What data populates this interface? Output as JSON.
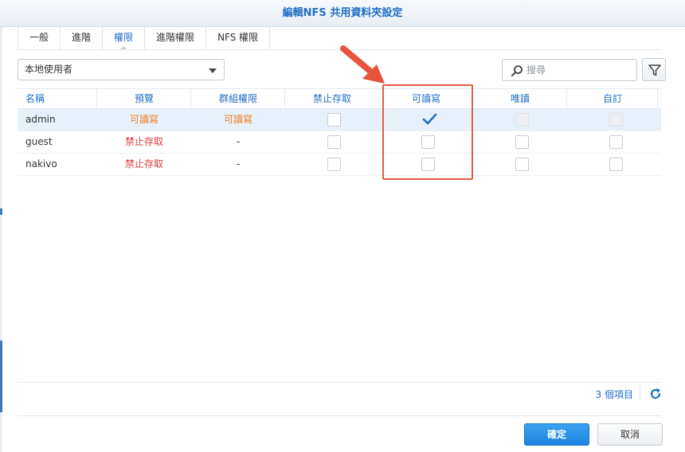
{
  "dialog": {
    "title": "編輯NFS 共用資料夾設定"
  },
  "tabs": [
    {
      "label": "一般"
    },
    {
      "label": "進階"
    },
    {
      "label": "權限"
    },
    {
      "label": "進階權限"
    },
    {
      "label": "NFS 權限"
    }
  ],
  "active_tab": "權限",
  "user_type_select": {
    "value": "本地使用者"
  },
  "search": {
    "placeholder": "搜尋"
  },
  "table": {
    "columns": [
      "名稱",
      "預覽",
      "群組權限",
      "禁止存取",
      "可讀寫",
      "唯讀",
      "自訂"
    ],
    "rows": [
      {
        "name": "admin",
        "preview": "可讀寫",
        "group": "可讀寫",
        "deny": false,
        "rw": true,
        "ro": false,
        "custom": false,
        "selected": true,
        "ro_disabled": true,
        "custom_disabled": true
      },
      {
        "name": "guest",
        "preview": "禁止存取",
        "group": "-",
        "deny": false,
        "rw": false,
        "ro": false,
        "custom": false,
        "selected": false,
        "ro_disabled": false,
        "custom_disabled": false
      },
      {
        "name": "nakivo",
        "preview": "禁止存取",
        "group": "-",
        "deny": false,
        "rw": false,
        "ro": false,
        "custom": false,
        "selected": false,
        "ro_disabled": false,
        "custom_disabled": false
      }
    ]
  },
  "footer": {
    "item_count": "3 個項目"
  },
  "buttons": {
    "ok": "確定",
    "cancel": "取消"
  },
  "colors": {
    "accent": "#1f6fc5",
    "rw_text": "#f07b1d",
    "deny_text": "#e43c3c",
    "highlight": "#e35d46",
    "primary_button": "#1c84e0"
  },
  "icons": {
    "search": "magnifier-icon",
    "filter": "funnel-icon",
    "refresh": "refresh-icon",
    "dropdown": "caret-down-icon",
    "check": "checkmark-icon",
    "annotation": "red-arrow-icon"
  }
}
